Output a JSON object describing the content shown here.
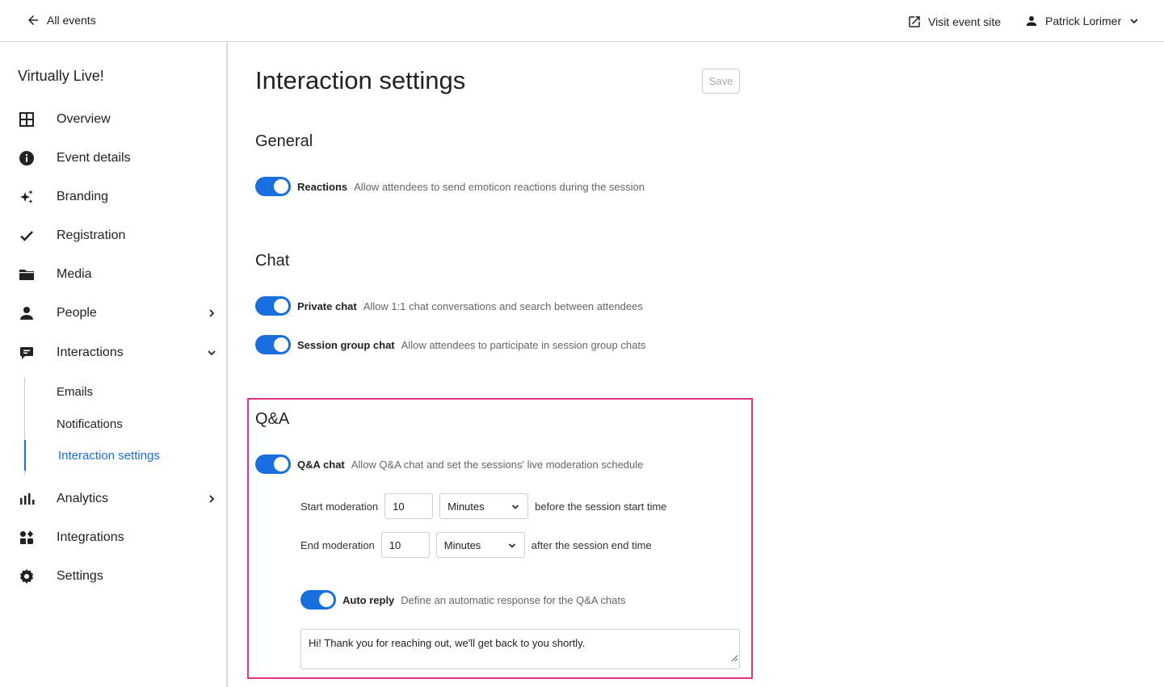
{
  "topbar": {
    "back_label": "All events",
    "visit_label": "Visit event site",
    "user_name": "Patrick Lorimer"
  },
  "sidebar": {
    "event_name": "Virtually Live!",
    "items": [
      {
        "label": "Overview",
        "icon": "grid-icon"
      },
      {
        "label": "Event details",
        "icon": "info-icon"
      },
      {
        "label": "Branding",
        "icon": "sparkle-icon"
      },
      {
        "label": "Registration",
        "icon": "check-icon"
      },
      {
        "label": "Media",
        "icon": "folder-icon"
      },
      {
        "label": "People",
        "icon": "person-icon"
      },
      {
        "label": "Interactions",
        "icon": "chat-icon"
      },
      {
        "label": "Analytics",
        "icon": "bar-chart-icon"
      },
      {
        "label": "Integrations",
        "icon": "integrations-icon"
      },
      {
        "label": "Settings",
        "icon": "gear-icon"
      }
    ],
    "sub_items": [
      "Emails",
      "Notifications",
      "Interaction settings"
    ],
    "active_sub_item": "Interaction settings"
  },
  "main": {
    "title": "Interaction settings",
    "save_label": "Save",
    "sections": {
      "general": {
        "title": "General",
        "toggles": [
          {
            "label": "Reactions",
            "desc": "Allow attendees to send emoticon reactions during the session",
            "on": true
          }
        ]
      },
      "chat": {
        "title": "Chat",
        "toggles": [
          {
            "label": "Private chat",
            "desc": "Allow 1:1 chat conversations and search between attendees",
            "on": true
          },
          {
            "label": "Session group chat",
            "desc": "Allow attendees to participate in session group chats",
            "on": true
          }
        ]
      },
      "qa": {
        "title": "Q&A",
        "chat_toggle": {
          "label": "Q&A chat",
          "desc": "Allow Q&A chat and set the sessions' live moderation schedule",
          "on": true
        },
        "start": {
          "label": "Start moderation",
          "value": "10",
          "unit": "Minutes",
          "after": "before the session start time"
        },
        "end": {
          "label": "End moderation",
          "value": "10",
          "unit": "Minutes",
          "after": "after the session end time"
        },
        "auto_reply": {
          "label": "Auto reply",
          "desc": "Define an automatic response for the Q&A chats",
          "on": true,
          "message": "Hi! Thank you for reaching out, we'll get back to you shortly."
        }
      }
    }
  },
  "colors": {
    "accent": "#1a6fe0",
    "highlight": "#e0308a"
  }
}
